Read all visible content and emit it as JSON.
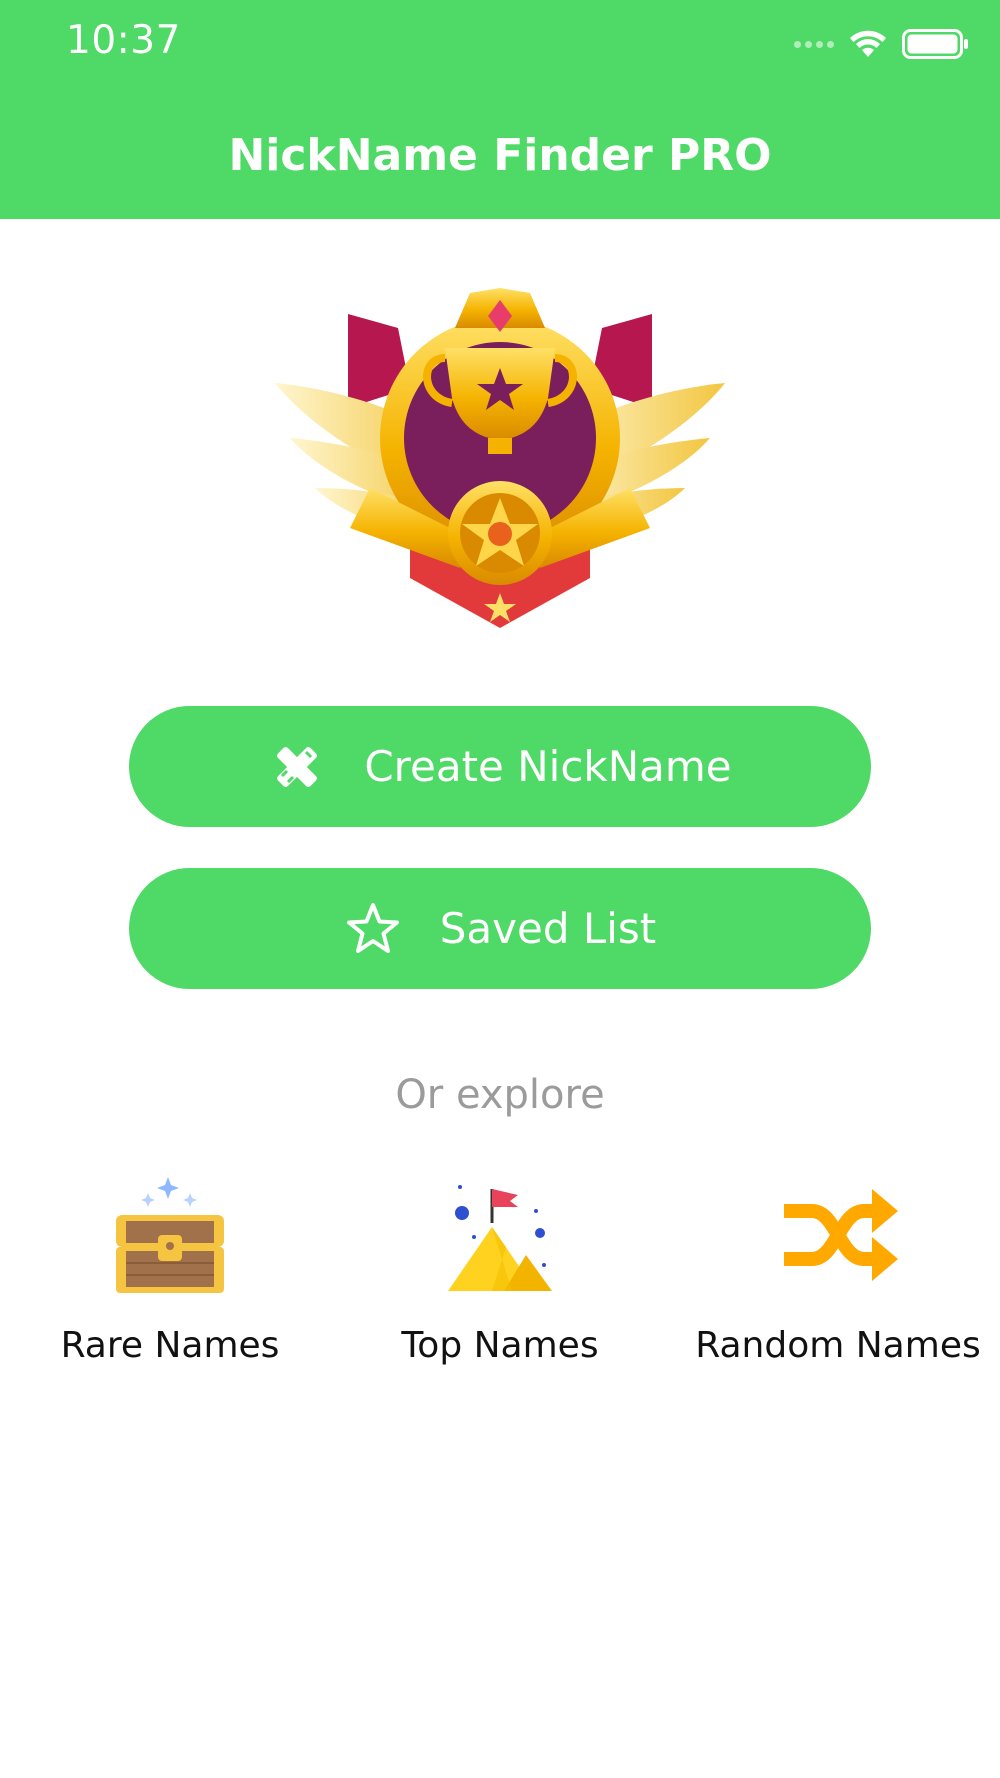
{
  "status_bar": {
    "time": "10:37",
    "icons": [
      "signal-dots-icon",
      "wifi-icon",
      "battery-icon"
    ]
  },
  "header": {
    "title": "NickName Finder PRO",
    "color": "#4fd966"
  },
  "emblem": {
    "icon": "trophy-badge-icon"
  },
  "buttons": {
    "create": {
      "label": "Create NickName",
      "icon": "pencil-ruler-icon"
    },
    "saved": {
      "label": "Saved List",
      "icon": "star-outline-icon"
    }
  },
  "explore": {
    "label": "Or explore",
    "items": [
      {
        "label": "Rare Names",
        "icon": "treasure-chest-icon"
      },
      {
        "label": "Top Names",
        "icon": "mountain-flag-icon"
      },
      {
        "label": "Random Names",
        "icon": "shuffle-icon"
      }
    ]
  },
  "colors": {
    "accent": "#4fd966",
    "muted_text": "#9b9b9b",
    "shuffle_orange": "#ffa800"
  }
}
